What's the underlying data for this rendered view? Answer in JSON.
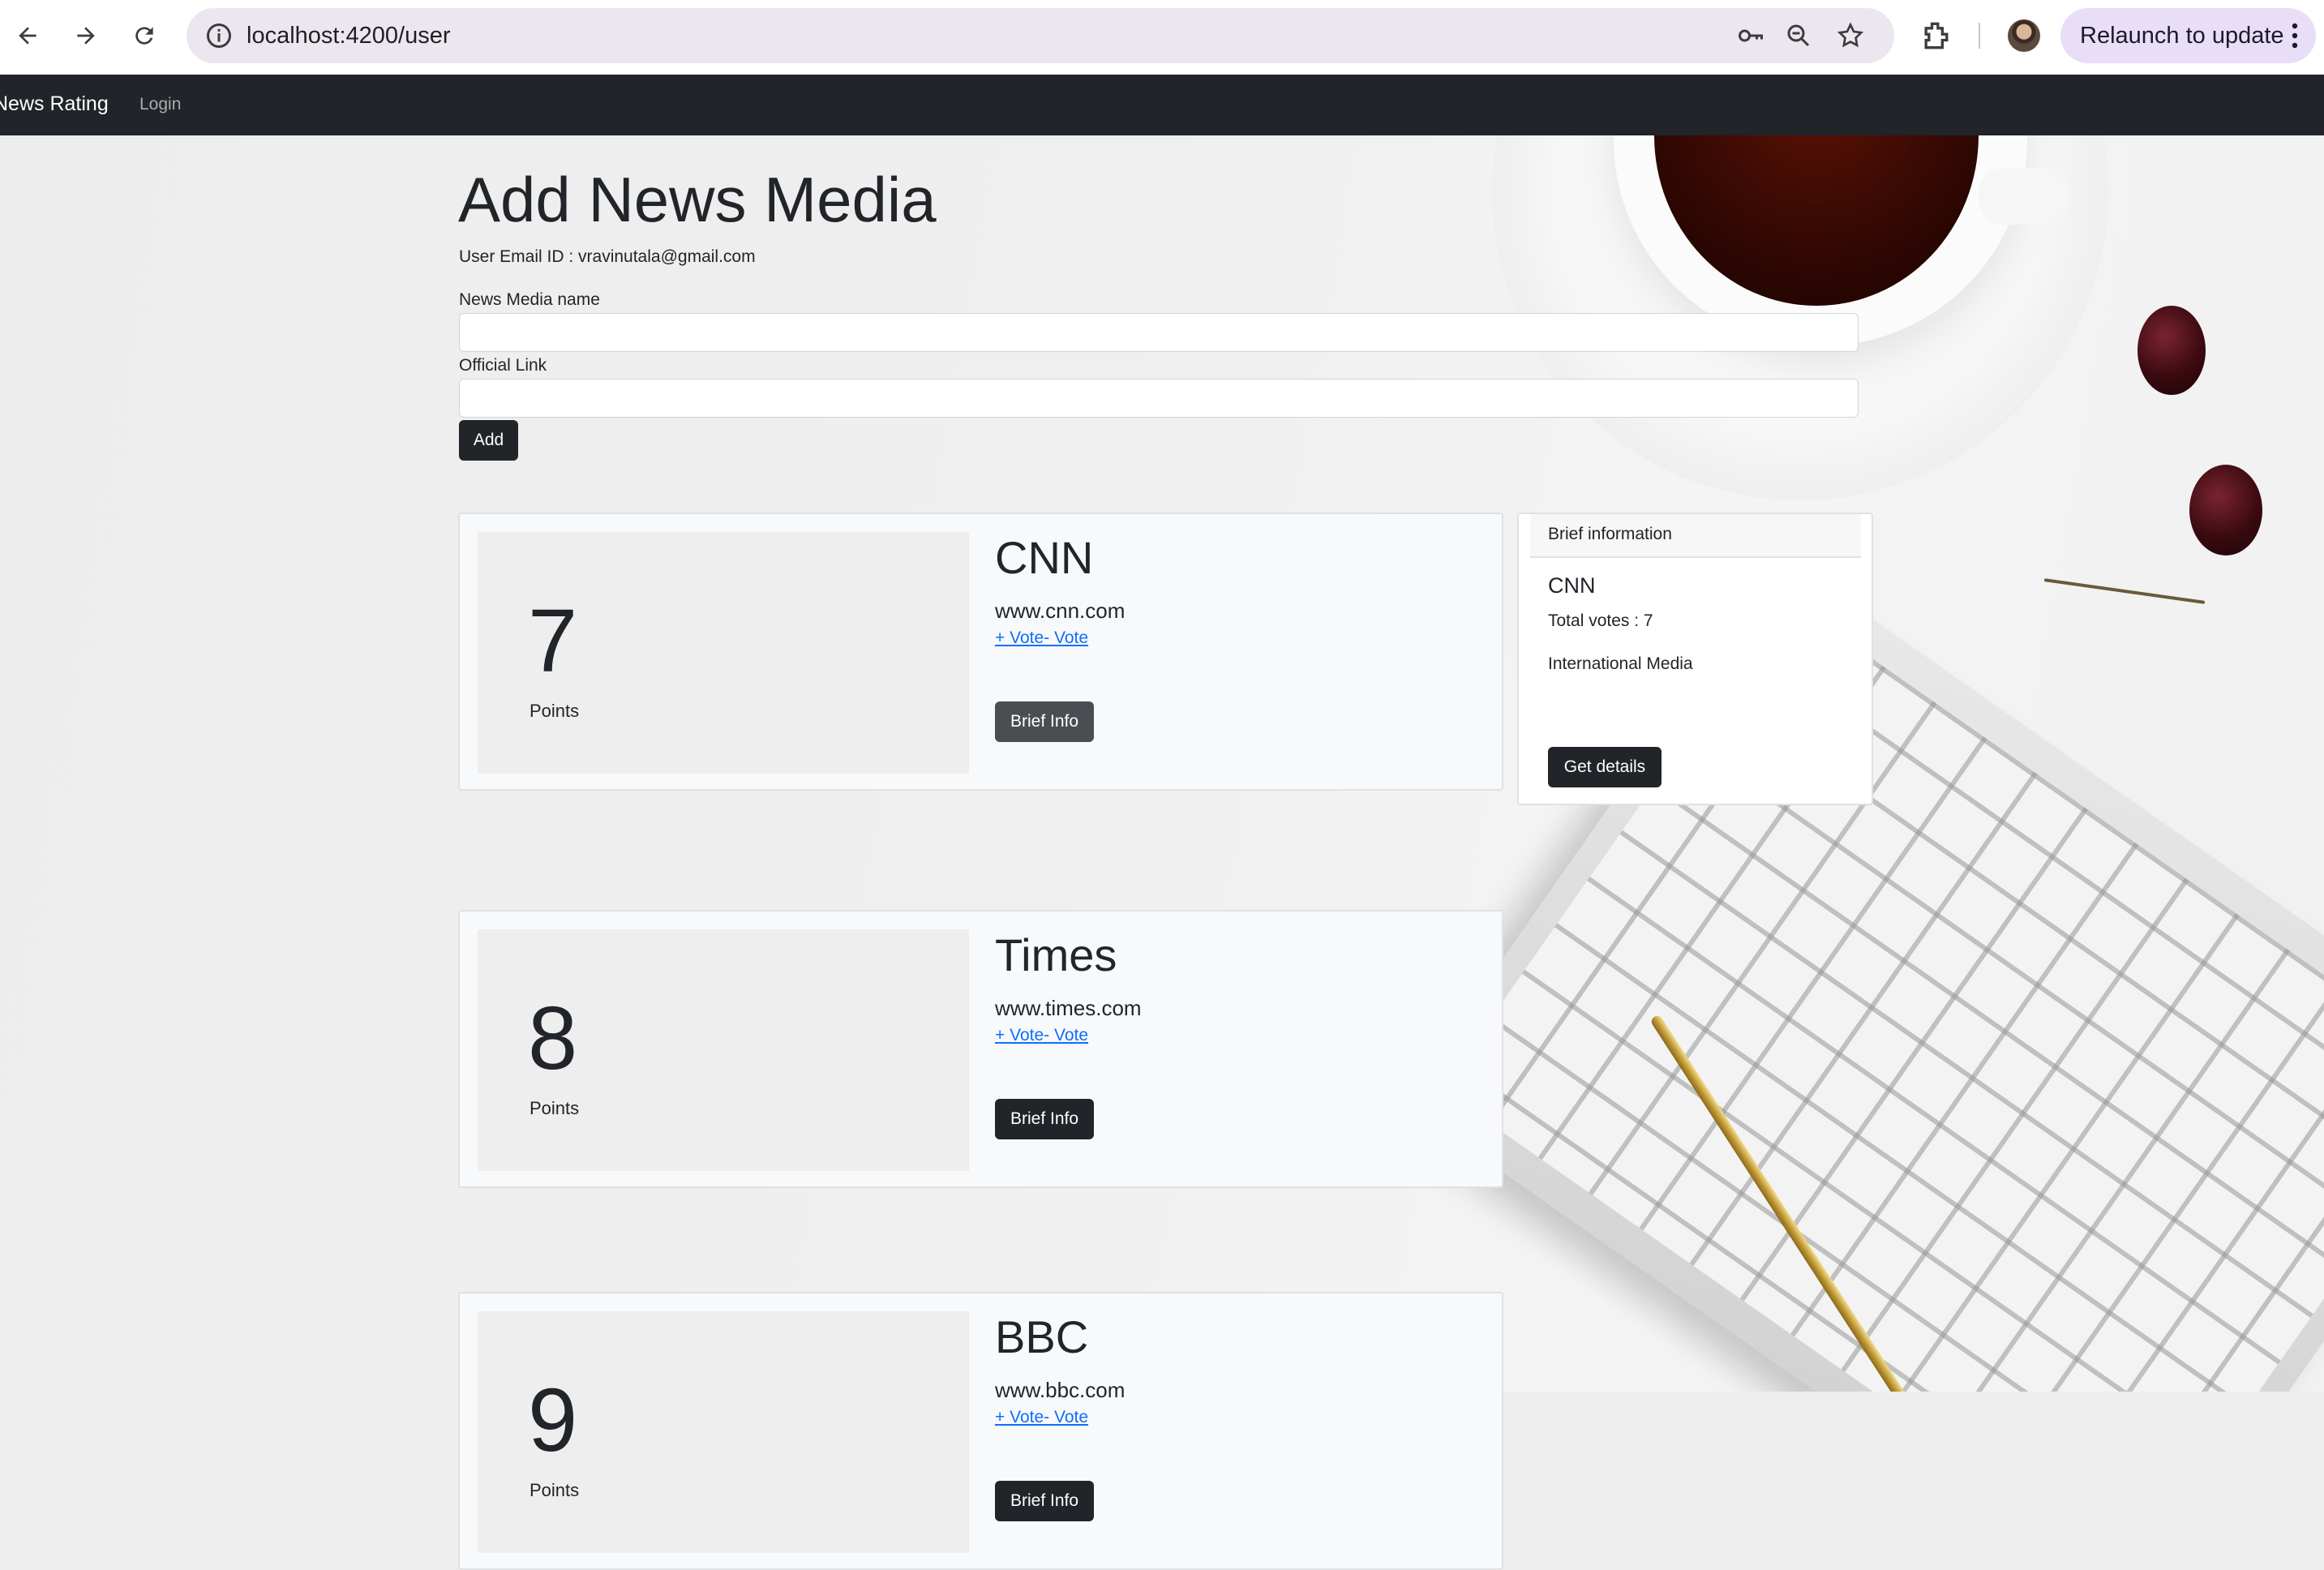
{
  "browser": {
    "url": "localhost:4200/user",
    "relaunch_label": "Relaunch to update",
    "icons": [
      "back-icon",
      "forward-icon",
      "reload-icon",
      "site-info-icon",
      "password-key-icon",
      "zoom-icon",
      "bookmark-star-icon",
      "extensions-icon",
      "profile-avatar",
      "more-menu-icon"
    ]
  },
  "navbar": {
    "brand": "News Rating",
    "login": "Login"
  },
  "form": {
    "title": "Add News Media",
    "email_line": "User Email ID : vravinutala@gmail.com",
    "name_label": "News Media name",
    "name_value": "",
    "link_label": "Official Link",
    "link_value": "",
    "add_label": "Add"
  },
  "media": [
    {
      "points": "7",
      "points_label": "Points",
      "name": "CNN",
      "url": "www.cnn.com",
      "vote_links": "+ Vote- Vote",
      "brief_label": "Brief Info"
    },
    {
      "points": "8",
      "points_label": "Points",
      "name": "Times",
      "url": "www.times.com",
      "vote_links": "+ Vote- Vote",
      "brief_label": "Brief Info"
    },
    {
      "points": "9",
      "points_label": "Points",
      "name": "BBC",
      "url": "www.bbc.com",
      "vote_links": "+ Vote- Vote",
      "brief_label": "Brief Info"
    }
  ],
  "brief_info": {
    "header": "Brief information",
    "name": "CNN",
    "total_votes": "Total votes : 7",
    "category": "International Media",
    "details_label": "Get details"
  },
  "colors": {
    "navbar_bg": "#212529",
    "button_dark": "#212529",
    "link_blue": "#0d6efd",
    "omnibox_bg": "#ece6f0",
    "relaunch_bg": "#e8def8"
  }
}
